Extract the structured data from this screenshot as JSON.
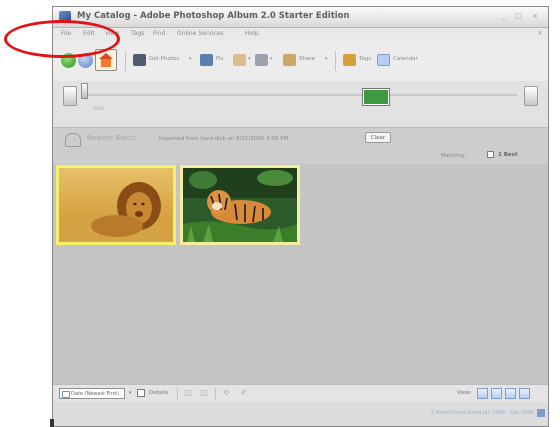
{
  "window": {
    "title": "My Catalog - Adobe Photoshop Album 2.0 Starter Edition",
    "controls": "_ □ ×",
    "close_glyph": "×"
  },
  "menu": [
    "File",
    "Edit",
    "View",
    "Tags",
    "Find",
    "Online Services",
    "Help"
  ],
  "toolbar": {
    "get_photos": "Get Photos",
    "fix": "Fix",
    "share": "Share",
    "tags": "Tags",
    "calendar": "Calendar",
    "dropdown_glyph": "▾"
  },
  "timeline": {
    "year_label": "2006"
  },
  "filter": {
    "name": "Newest Batch",
    "description": "Imported from hard disk on 8/31/2006 3:06 PM",
    "clear_label": "Clear",
    "match_label": "Matching:",
    "match_value": "1 Best"
  },
  "photos": [
    {
      "subject": "Lion"
    },
    {
      "subject": "Tiger"
    }
  ],
  "statusbar": {
    "sort_value": "Date (Newest First)",
    "dropdown_glyph": "▾",
    "details_label": "Details",
    "view_label": "View:",
    "icons": [
      "◫",
      "◫",
      "⟲",
      "✐"
    ]
  },
  "footer": {
    "count_text": "2 items found dated Jan 2006 - Dec 2006"
  },
  "colors": {
    "selection_border": "#f5f06a",
    "annotation": "#e01414",
    "timeline_marker": "#3e9a3e"
  }
}
